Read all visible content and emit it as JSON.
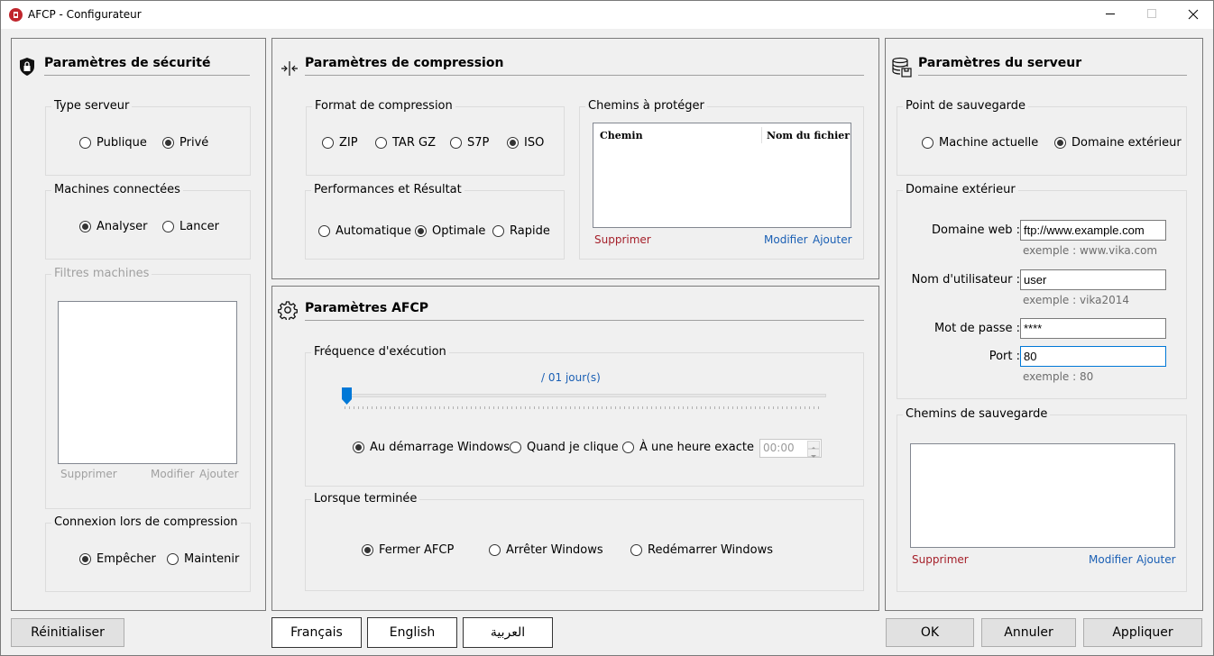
{
  "window": {
    "title": "AFCP - Configurateur"
  },
  "security": {
    "title": "Paramètres de sécurité",
    "server_type": {
      "label": "Type serveur",
      "options": [
        "Publique",
        "Privé"
      ],
      "selected": "Privé"
    },
    "machines": {
      "label": "Machines connectées",
      "options": [
        "Analyser",
        "Lancer"
      ],
      "selected": "Analyser"
    },
    "filters": {
      "label": "Filtres machines",
      "delete": "Supprimer",
      "modify": "Modifier",
      "add": "Ajouter"
    },
    "connection": {
      "label": "Connexion lors de compression",
      "options": [
        "Empêcher",
        "Maintenir"
      ],
      "selected": "Empêcher"
    }
  },
  "compression": {
    "title": "Paramètres de compression",
    "format": {
      "label": "Format de compression",
      "options": [
        "ZIP",
        "TAR GZ",
        "S7P",
        "ISO"
      ],
      "selected": "ISO"
    },
    "performance": {
      "label": "Performances et Résultat",
      "options": [
        "Automatique",
        "Optimale",
        "Rapide"
      ],
      "selected": "Optimale"
    },
    "paths": {
      "label": "Chemins à protéger",
      "col_path": "Chemin",
      "col_file": "Nom du fichier",
      "delete": "Supprimer",
      "modify": "Modifier",
      "add": "Ajouter"
    }
  },
  "afcp": {
    "title": "Paramètres AFCP",
    "frequency": {
      "label": "Fréquence d'exécution",
      "value_text": "/ 01 jour(s)",
      "slider_value": 0,
      "options": [
        "Au démarrage Windows",
        "Quand je clique",
        "À une heure exacte"
      ],
      "selected": "Au démarrage Windows",
      "time": "00:00"
    },
    "on_finish": {
      "label": "Lorsque terminée",
      "options": [
        "Fermer AFCP",
        "Arrêter Windows",
        "Redémarrer Windows"
      ],
      "selected": "Fermer AFCP"
    }
  },
  "server": {
    "title": "Paramètres du serveur",
    "backup_point": {
      "label": "Point de sauvegarde",
      "options": [
        "Machine actuelle",
        "Domaine extérieur"
      ],
      "selected": "Domaine extérieur"
    },
    "external": {
      "label": "Domaine extérieur",
      "web_label": "Domaine web :",
      "web_value": "ftp://www.example.com",
      "web_hint": "exemple : www.vika.com",
      "user_label": "Nom d'utilisateur :",
      "user_value": "user",
      "user_hint": "exemple : vika2014",
      "pass_label": "Mot de passe :",
      "pass_value": "****",
      "port_label": "Port :",
      "port_value": "80",
      "port_hint": "exemple : 80"
    },
    "backup_paths": {
      "label": "Chemins de sauvegarde",
      "delete": "Supprimer",
      "modify": "Modifier",
      "add": "Ajouter"
    }
  },
  "footer": {
    "reset": "Réinitialiser",
    "lang_fr": "Français",
    "lang_en": "English",
    "lang_ar": "العربية",
    "ok": "OK",
    "cancel": "Annuler",
    "apply": "Appliquer"
  }
}
